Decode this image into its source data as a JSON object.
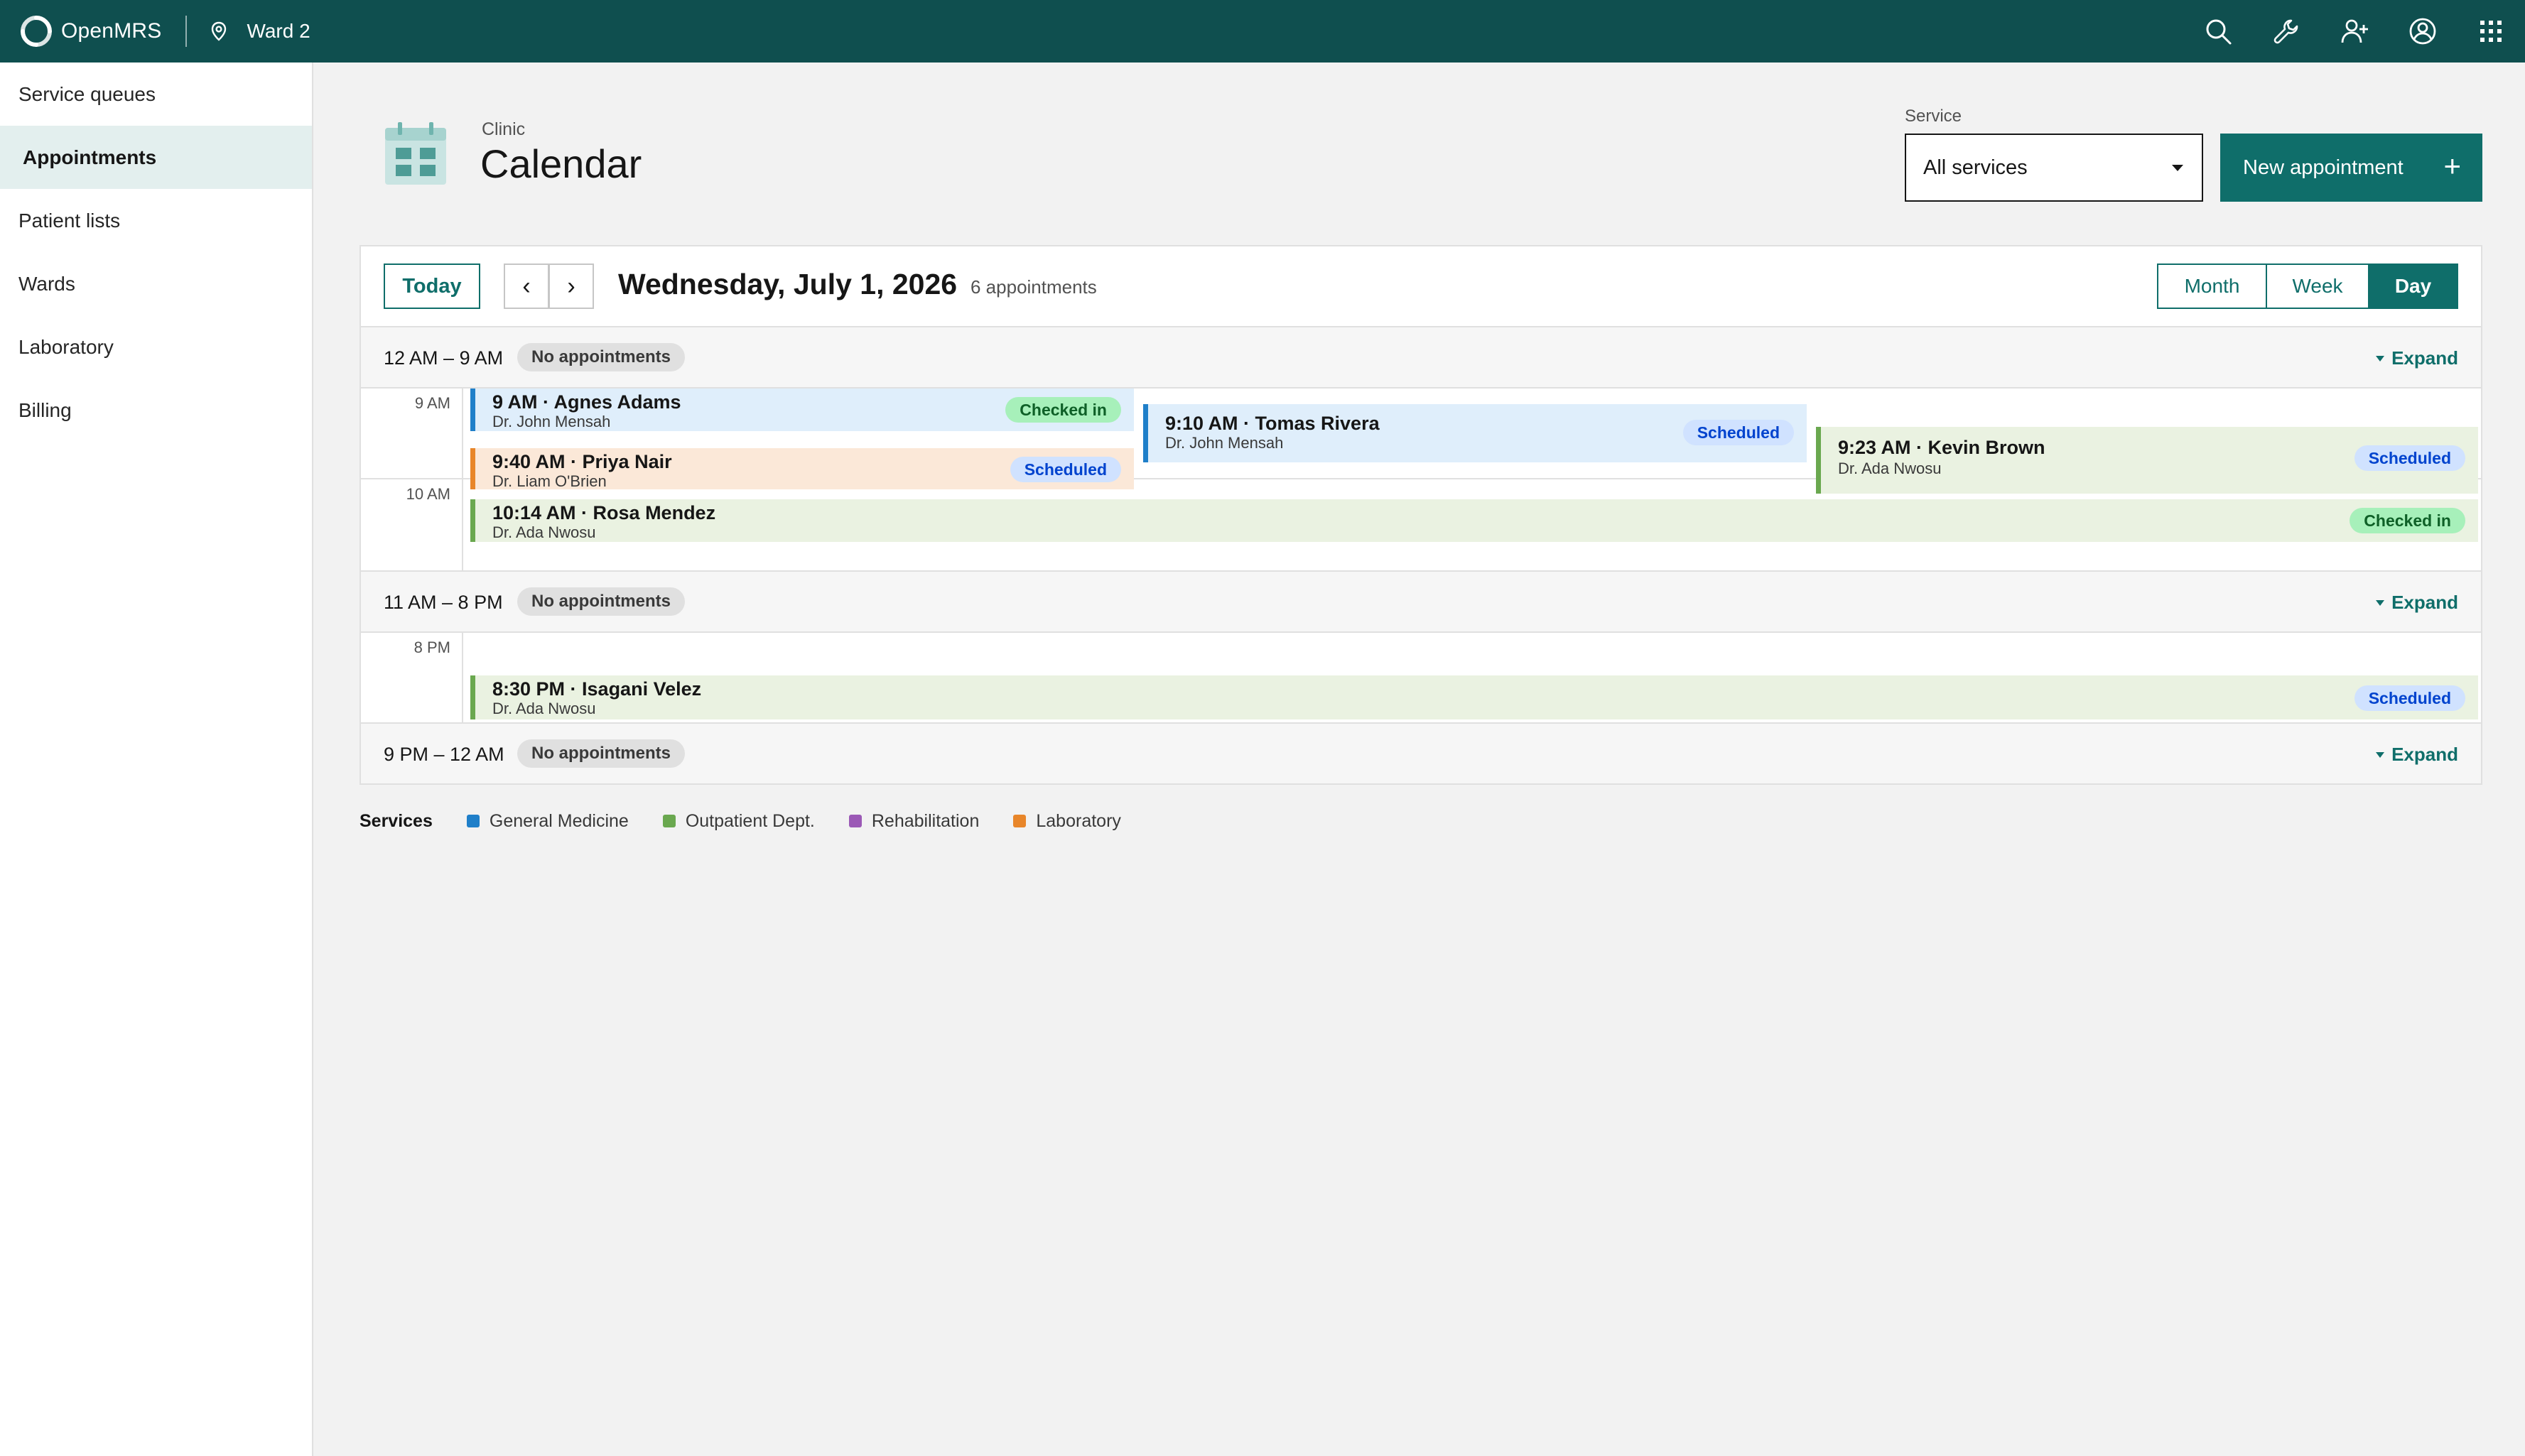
{
  "brand": {
    "name": "OpenMRS"
  },
  "location": {
    "name": "Ward 2",
    "icon": "location-pin-icon"
  },
  "header_actions": [
    {
      "name": "search-icon"
    },
    {
      "name": "wrench-icon"
    },
    {
      "name": "add-patient-icon"
    },
    {
      "name": "user-avatar-icon"
    },
    {
      "name": "app-switcher-icon"
    }
  ],
  "sidebar": {
    "items": [
      {
        "label": "Service queues"
      },
      {
        "label": "Appointments",
        "active": true
      },
      {
        "label": "Patient lists"
      },
      {
        "label": "Wards"
      },
      {
        "label": "Laboratory"
      },
      {
        "label": "Billing"
      }
    ]
  },
  "page": {
    "eyebrow": "Clinic",
    "title": "Calendar",
    "icon": "calendar-icon"
  },
  "service_filter": {
    "label": "Service",
    "value": "All services"
  },
  "new_appointment": {
    "label": "New appointment",
    "icon": "+"
  },
  "toolbar": {
    "today": "Today",
    "prev": "‹",
    "next": "›",
    "date": "Wednesday, July 1, 2026",
    "count": "6 appointments",
    "views": [
      "Month",
      "Week",
      "Day"
    ],
    "active_view": "Day"
  },
  "collapsed": [
    {
      "range": "12 AM – 9 AM",
      "badge": "No appointments",
      "expand": "Expand"
    },
    {
      "range": "11 AM – 8 PM",
      "badge": "No appointments",
      "expand": "Expand"
    },
    {
      "range": "9 PM – 12 AM",
      "badge": "No appointments",
      "expand": "Expand"
    }
  ],
  "hours": [
    "9 AM",
    "10 AM",
    "8 PM"
  ],
  "appointments": [
    {
      "title": "9 AM · Agnes Adams",
      "doctor": "Dr. John Mensah",
      "status": "Checked in"
    },
    {
      "title": "9:40 AM · Priya Nair",
      "doctor": "Dr. Liam O'Brien",
      "status": "Scheduled"
    },
    {
      "title": "9:10 AM · Tomas Rivera",
      "doctor": "Dr. John Mensah",
      "status": "Scheduled"
    },
    {
      "title": "9:23 AM · Kevin Brown",
      "doctor": "Dr. Ada Nwosu",
      "status": "Scheduled"
    },
    {
      "title": "10:14 AM · Rosa Mendez",
      "doctor": "Dr. Ada Nwosu",
      "status": "Checked in"
    },
    {
      "title": "8:30 PM · Isagani Velez",
      "doctor": "Dr. Ada Nwosu",
      "status": "Scheduled"
    }
  ],
  "legend": {
    "title": "Services",
    "items": [
      {
        "label": "General Medicine",
        "color": "#1f7fc9"
      },
      {
        "label": "Outpatient Dept.",
        "color": "#6aa84f"
      },
      {
        "label": "Rehabilitation",
        "color": "#9b59b6"
      },
      {
        "label": "Laboratory",
        "color": "#e8862a"
      }
    ]
  }
}
